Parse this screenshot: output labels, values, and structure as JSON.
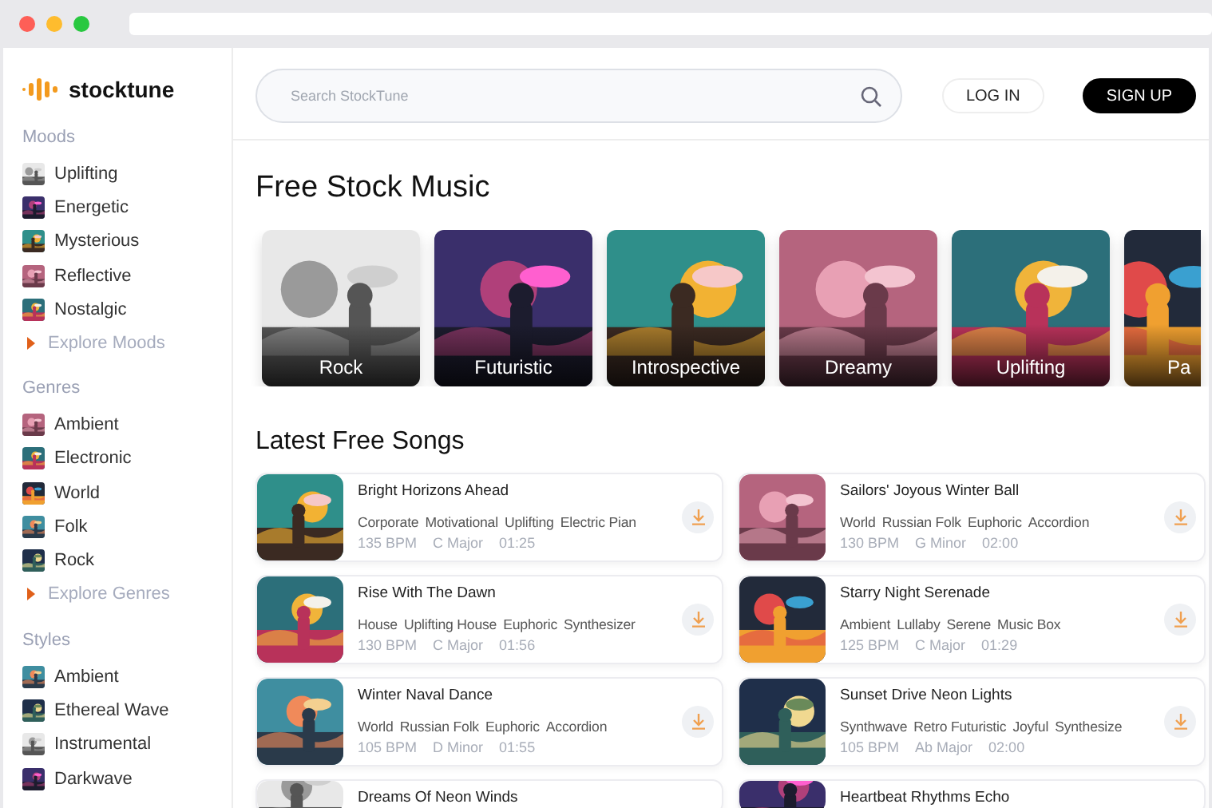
{
  "brand": {
    "name": "stocktune"
  },
  "sidebar": {
    "sections": [
      {
        "heading": "Moods",
        "items": [
          {
            "label": "Uplifting"
          },
          {
            "label": "Energetic"
          },
          {
            "label": "Mysterious"
          },
          {
            "label": "Reflective"
          },
          {
            "label": "Nostalgic"
          }
        ],
        "explore": "Explore Moods"
      },
      {
        "heading": "Genres",
        "items": [
          {
            "label": "Ambient"
          },
          {
            "label": "Electronic"
          },
          {
            "label": "World"
          },
          {
            "label": "Folk"
          },
          {
            "label": "Rock"
          }
        ],
        "explore": "Explore Genres"
      },
      {
        "heading": "Styles",
        "items": [
          {
            "label": "Ambient"
          },
          {
            "label": "Ethereal Wave"
          },
          {
            "label": "Instrumental"
          },
          {
            "label": "Darkwave"
          }
        ]
      }
    ]
  },
  "search": {
    "placeholder": "Search StockTune"
  },
  "header_buttons": [
    {
      "label": "LOG IN",
      "kind": "outline"
    },
    {
      "label": "SIGN UP",
      "kind": "filled"
    }
  ],
  "featured": {
    "title": "Free Stock Music",
    "cards": [
      {
        "label": "Rock"
      },
      {
        "label": "Futuristic"
      },
      {
        "label": "Introspective"
      },
      {
        "label": "Dreamy"
      },
      {
        "label": "Uplifting"
      },
      {
        "label": "Pa"
      }
    ]
  },
  "latest": {
    "title": "Latest Free Songs",
    "songs": [
      {
        "title": "Bright Horizons Ahead",
        "tags": [
          "Corporate",
          "Motivational",
          "Uplifting",
          "Electric Pian"
        ],
        "bpm": "135 BPM",
        "key": "C Major",
        "duration": "01:25"
      },
      {
        "title": "Sailors' Joyous Winter Ball",
        "tags": [
          "World",
          "Russian Folk",
          "Euphoric",
          "Accordion"
        ],
        "bpm": "130 BPM",
        "key": "G Minor",
        "duration": "02:00"
      },
      {
        "title": "Rise With The Dawn",
        "tags": [
          "House",
          "Uplifting House",
          "Euphoric",
          "Synthesizer"
        ],
        "bpm": "130 BPM",
        "key": "C Major",
        "duration": "01:56"
      },
      {
        "title": "Starry Night Serenade",
        "tags": [
          "Ambient",
          "Lullaby",
          "Serene",
          "Music Box"
        ],
        "bpm": "125 BPM",
        "key": "C Major",
        "duration": "01:29"
      },
      {
        "title": "Winter Naval Dance",
        "tags": [
          "World",
          "Russian Folk",
          "Euphoric",
          "Accordion"
        ],
        "bpm": "105 BPM",
        "key": "D Minor",
        "duration": "01:55"
      },
      {
        "title": "Sunset Drive Neon Lights",
        "tags": [
          "Synthwave",
          "Retro Futuristic",
          "Joyful",
          "Synthesize"
        ],
        "bpm": "105 BPM",
        "key": "Ab Major",
        "duration": "02:00"
      },
      {
        "title": "Dreams Of Neon Winds"
      },
      {
        "title": "Heartbeat Rhythms Echo"
      }
    ]
  }
}
